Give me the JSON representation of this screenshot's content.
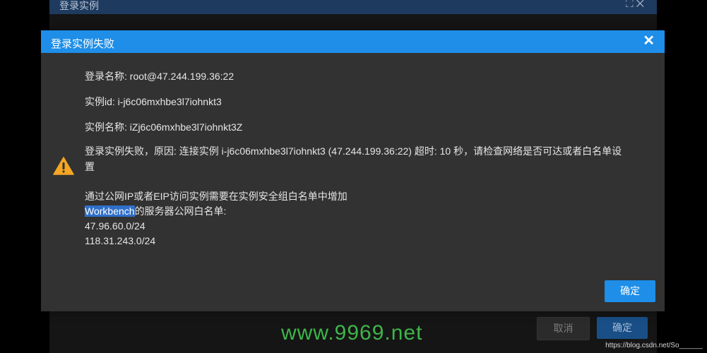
{
  "background_dialog": {
    "title": "登录实例",
    "icons": "⛶✕",
    "cancel_label": "取消",
    "ok_label": "确定"
  },
  "modal": {
    "title": "登录实例失败",
    "close": "✕",
    "login_name": "登录名称: root@47.244.199.36:22",
    "instance_id": "实例id: i-j6c06mxhbe3l7iohnkt3",
    "instance_name": "实例名称: iZj6c06mxhbe3l7iohnkt3Z",
    "failure_line1": "登录实例失败，原因: 连接实例 i-j6c06mxhbe3l7iohnkt3 (47.244.199.36:22) 超时: 10 秒，请检查网络是否可达或者白名单设",
    "failure_line2": "置",
    "public_line": "通过公网IP或者EIP访问实例需要在实例安全组白名单中增加",
    "workbench_highlight": "Workbench",
    "workbench_rest": "的服务器公网白名单:",
    "ip1": "47.96.60.0/24",
    "ip2": "118.31.243.0/24",
    "ok_label": "确定"
  },
  "watermark": "www.9969.net",
  "source_text": "https://blog.csdn.net/So______",
  "colors": {
    "accent": "#1e8ee8",
    "warning": "#f5a623",
    "watermark": "#3eb54a"
  },
  "icons": {
    "warning": "warning-icon",
    "close": "close-icon",
    "fullscreen": "fullscreen-icon"
  }
}
